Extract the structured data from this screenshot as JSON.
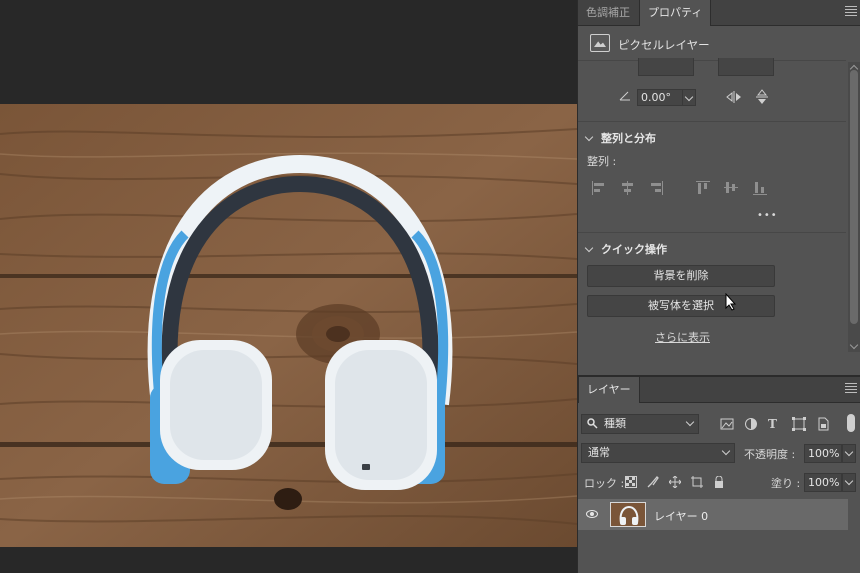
{
  "properties_panel": {
    "tabs": [
      {
        "label": "色調補正",
        "active": false
      },
      {
        "label": "プロパティ",
        "active": true
      }
    ],
    "header_title": "ピクセルレイヤー",
    "transform": {
      "angle_value": "0.00°"
    },
    "align_section": {
      "title": "整列と分布",
      "align_label": "整列 :",
      "more_label": "•••"
    },
    "quick_actions": {
      "title": "クイック操作",
      "remove_bg_label": "背景を削除",
      "select_subject_label": "被写体を選択",
      "more_link": "さらに表示"
    }
  },
  "layers_panel": {
    "tab_label": "レイヤー",
    "filter_kind": "種類",
    "blend_mode": "通常",
    "opacity_label": "不透明度 :",
    "opacity_value": "100%",
    "lock_label": "ロック :",
    "fill_label": "塗り :",
    "fill_value": "100%",
    "layers": [
      {
        "name": "レイヤー 0",
        "visible": true,
        "selected": true
      }
    ]
  },
  "colors": {
    "app_background": "#282828",
    "panel_background": "#535353",
    "tab_bar": "#424242",
    "selected_layer": "#696969",
    "headphone_accent": "#4aa3e0"
  }
}
